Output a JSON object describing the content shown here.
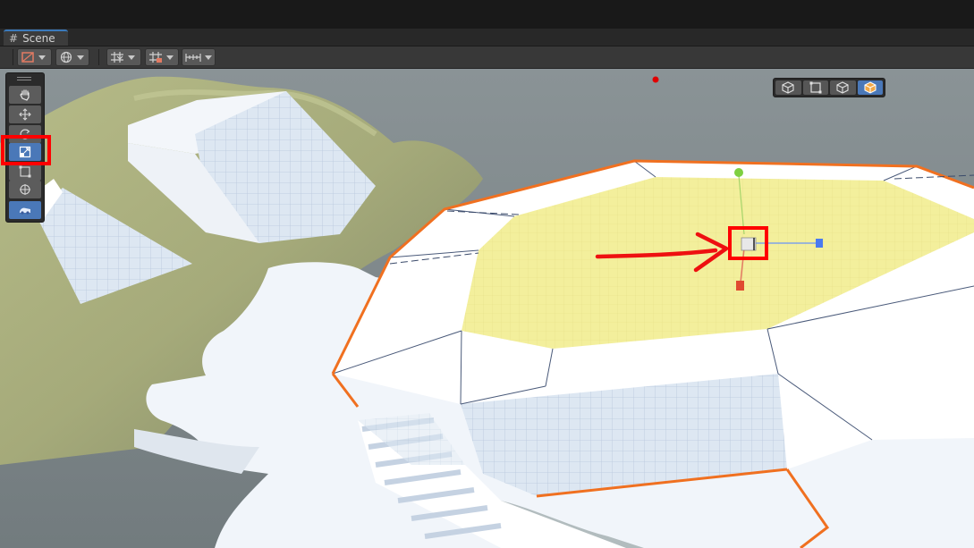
{
  "tab": {
    "label": "Scene",
    "icon": "hash-icon"
  },
  "toolbar": {
    "buttons": [
      {
        "name": "draw-mode-dropdown",
        "icon": "shading-mode-icon"
      },
      {
        "name": "global-local-dropdown",
        "icon": "globe-icon"
      },
      {
        "name": "grid-snap-dropdown",
        "icon": "grid-snap-icon"
      },
      {
        "name": "increment-snap-dropdown",
        "icon": "increment-snap-icon"
      },
      {
        "name": "ruler-dropdown",
        "icon": "ruler-icon"
      }
    ]
  },
  "tools": {
    "items": [
      "hand-tool",
      "move-tool",
      "rotate-tool",
      "scale-tool",
      "rect-tool",
      "transform-tool",
      "custom-editor-tool"
    ],
    "active": "scale-tool"
  },
  "orientation": {
    "items": [
      "cube-icon",
      "rect-select-icon",
      "cube-icon",
      "cube-solid-icon"
    ],
    "active_index": 3
  },
  "colors": {
    "accent": "#4a78b8",
    "annotation": "#ff0000",
    "selection_outline": "#f07020",
    "selected_face": "#f3ef9c"
  }
}
